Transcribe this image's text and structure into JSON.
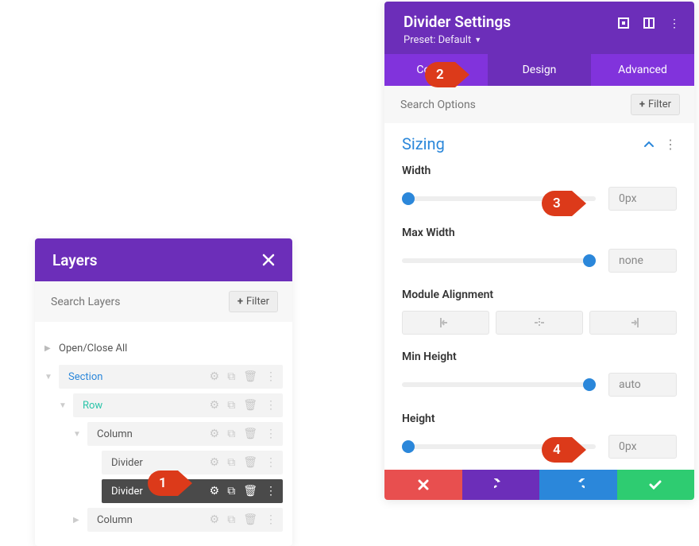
{
  "layers": {
    "title": "Layers",
    "search_placeholder": "Search Layers",
    "filter_label": "Filter",
    "open_close_all": "Open/Close All",
    "items": {
      "section": "Section",
      "row": "Row",
      "column1": "Column",
      "divider1": "Divider",
      "divider2": "Divider",
      "column2": "Column"
    }
  },
  "settings": {
    "title": "Divider Settings",
    "preset": "Preset: Default",
    "tabs": {
      "content": "Content",
      "design": "Design",
      "advanced": "Advanced"
    },
    "search_placeholder": "Search Options",
    "filter_label": "Filter",
    "section_title": "Sizing",
    "fields": {
      "width": {
        "label": "Width",
        "value": "0px"
      },
      "max_width": {
        "label": "Max Width",
        "value": "none"
      },
      "alignment": {
        "label": "Module Alignment"
      },
      "min_height": {
        "label": "Min Height",
        "value": "auto"
      },
      "height": {
        "label": "Height",
        "value": "0px"
      }
    }
  },
  "annotations": {
    "n1": "1",
    "n2": "2",
    "n3": "3",
    "n4": "4"
  },
  "colors": {
    "brand": "#6c2eb9",
    "accent": "#2b87da"
  }
}
